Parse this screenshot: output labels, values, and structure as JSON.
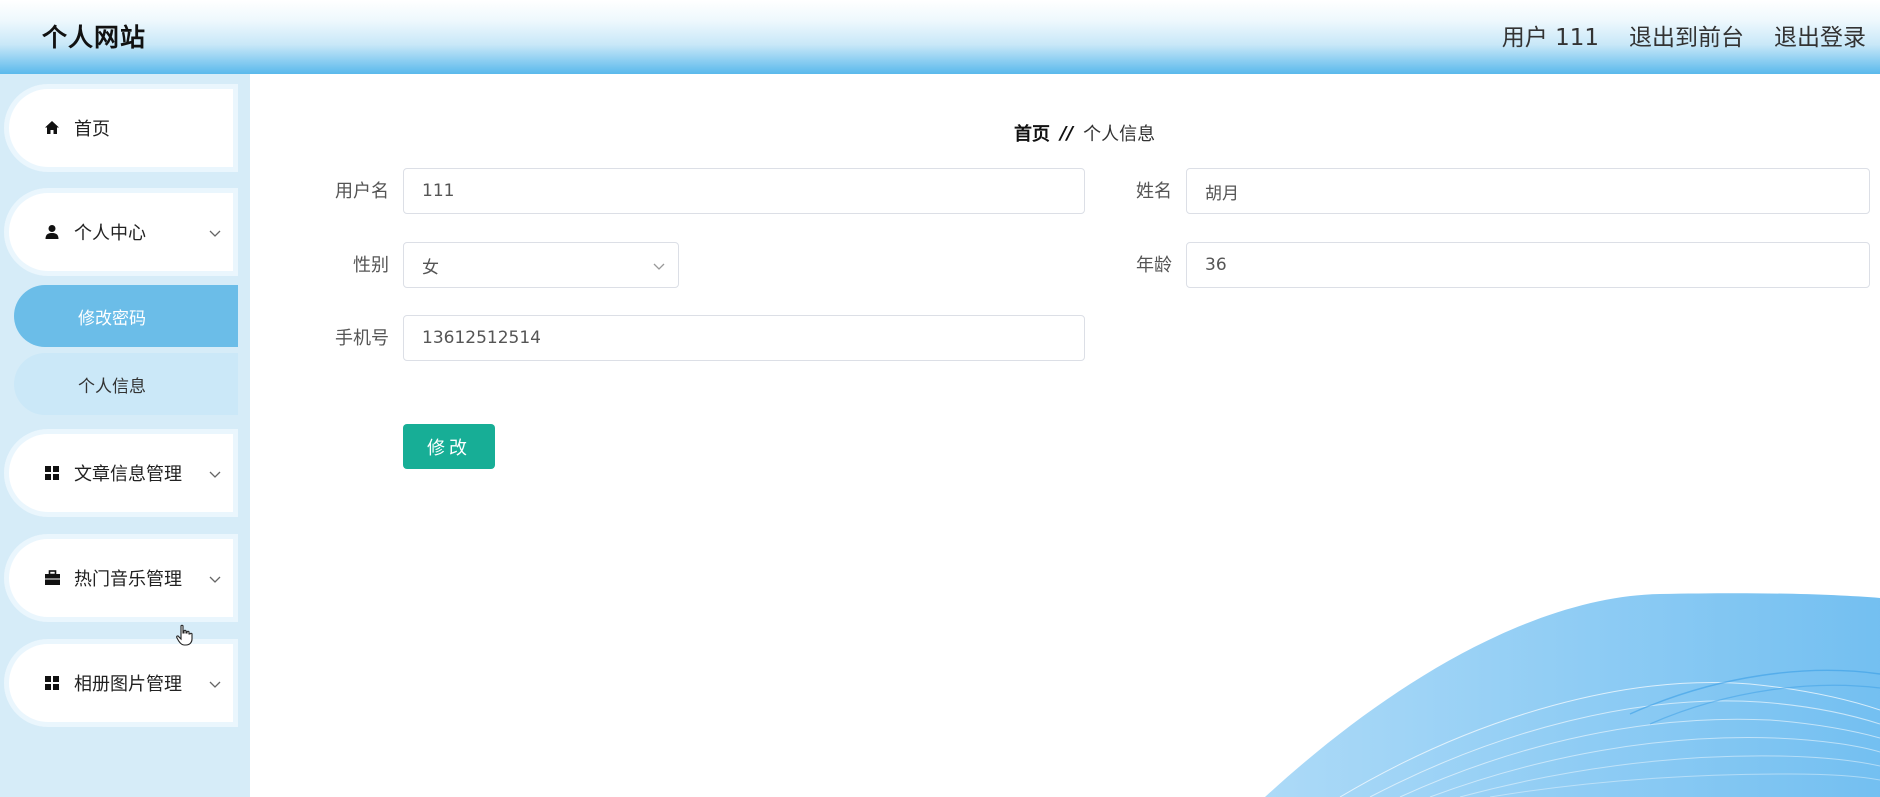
{
  "header": {
    "brand": "个人网站",
    "user_label": "用户 111",
    "to_front_label": "退出到前台",
    "logout_label": "退出登录"
  },
  "sidebar": {
    "items": [
      {
        "label": "首页",
        "icon": "home-icon"
      },
      {
        "label": "个人中心",
        "icon": "user-icon",
        "expanded": true,
        "children": [
          {
            "label": "修改密码",
            "active": true
          },
          {
            "label": "个人信息",
            "active": false
          }
        ]
      },
      {
        "label": "文章信息管理",
        "icon": "grid-icon"
      },
      {
        "label": "热门音乐管理",
        "icon": "briefcase-icon"
      },
      {
        "label": "相册图片管理",
        "icon": "grid-icon"
      }
    ]
  },
  "breadcrumb": {
    "home": "首页",
    "separator": "//",
    "current": "个人信息"
  },
  "form": {
    "username_label": "用户名",
    "username_value": "111",
    "name_label": "姓名",
    "name_value": "胡月",
    "gender_label": "性别",
    "gender_value": "女",
    "age_label": "年龄",
    "age_value": "36",
    "phone_label": "手机号",
    "phone_value": "13612512514",
    "submit_label": "修改"
  },
  "colors": {
    "header_gradient_bottom": "#5ab9ec",
    "sidebar_bg": "#d6ecf8",
    "active_submenu": "#6bbde8",
    "submit_button": "#17ae96",
    "wave": "#8fcdf5"
  }
}
